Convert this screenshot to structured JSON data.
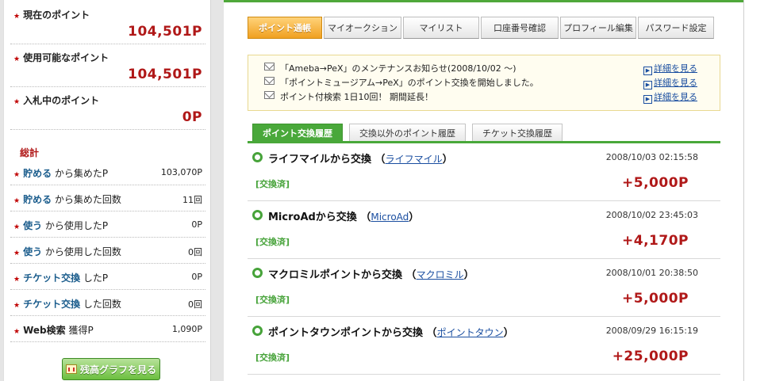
{
  "sidebar": {
    "current_points": {
      "label": "現在のポイント",
      "value": "104,501P"
    },
    "usable_points": {
      "label": "使用可能なポイント",
      "value": "104,501P"
    },
    "bidding_points": {
      "label": "入札中のポイント",
      "value": "0P"
    },
    "summary_title": "総計",
    "stats": [
      {
        "keyword": "貯める",
        "suffix": " から集めたP",
        "value": "103,070P"
      },
      {
        "keyword": "貯める",
        "suffix": " から集めた回数",
        "value": "11回"
      },
      {
        "keyword": "使う",
        "suffix": " から使用したP",
        "value": "0P"
      },
      {
        "keyword": "使う",
        "suffix": " から使用した回数",
        "value": "0回"
      },
      {
        "keyword": "チケット交換",
        "suffix": " したP",
        "value": "0P"
      },
      {
        "keyword": "チケット交換",
        "suffix": " した回数",
        "value": "0回"
      },
      {
        "keyword": "Web検索",
        "suffix": " 獲得P",
        "value": "1,090P"
      }
    ],
    "graph_button": "残高グラフを見る"
  },
  "tabs": [
    "ポイント通帳",
    "マイオークション",
    "マイリスト",
    "口座番号確認",
    "プロフィール編集",
    "パスワード設定"
  ],
  "notices": [
    {
      "text": "「Ameba→PeX」のメンテナンスお知らせ(2008/10/02 ～)",
      "link": "詳細を見る"
    },
    {
      "text": "「ポイントミュージアム→PeX」のポイント交換を開始しました。",
      "link": "詳細を見る"
    },
    {
      "text": "ポイント付検索 1日10回！ 期間延長！",
      "link": "詳細を見る"
    }
  ],
  "subtabs": [
    "ポイント交換履歴",
    "交換以外のポイント履歴",
    "チケット交換履歴"
  ],
  "entries": [
    {
      "title": "ライフマイルから交換",
      "source": "ライフマイル",
      "date": "2008/10/03 02:15:58",
      "status": "[交換済]",
      "amount": "+5,000P"
    },
    {
      "title": "MicroAdから交換",
      "source": "MicroAd",
      "date": "2008/10/02 23:45:03",
      "status": "[交換済]",
      "amount": "+4,170P"
    },
    {
      "title": "マクロミルポイントから交換",
      "source": "マクロミル",
      "date": "2008/10/01 20:38:50",
      "status": "[交換済]",
      "amount": "+5,000P"
    },
    {
      "title": "ポイントタウンポイントから交換",
      "source": "ポイントタウン",
      "date": "2008/09/29 16:15:19",
      "status": "[交換済]",
      "amount": "+25,000P"
    }
  ],
  "colors": {
    "accent_green": "#49a83a",
    "active_tab_orange": "#f0a020",
    "point_red": "#b01818",
    "link_blue": "#1a4ea0"
  }
}
